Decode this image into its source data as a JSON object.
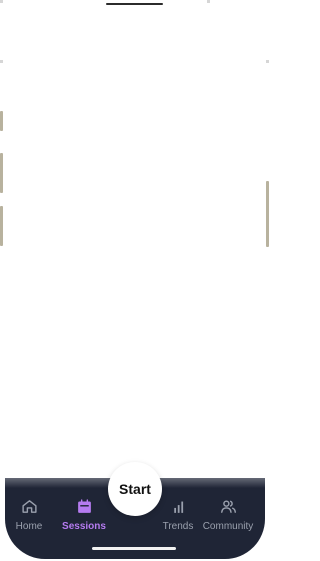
{
  "tabbar": {
    "tabs": [
      {
        "id": "home",
        "label": "Home",
        "icon": "home-icon",
        "active": false
      },
      {
        "id": "sessions",
        "label": "Sessions",
        "icon": "calendar-icon",
        "active": true
      },
      {
        "id": "trends",
        "label": "Trends",
        "icon": "bar-chart-icon",
        "active": false
      },
      {
        "id": "community",
        "label": "Community",
        "icon": "users-icon",
        "active": false
      }
    ],
    "start_label": "Start"
  },
  "colors": {
    "tabbar_bg": "#1f2536",
    "active": "#b57bf0",
    "inactive": "#9aa0ad"
  }
}
